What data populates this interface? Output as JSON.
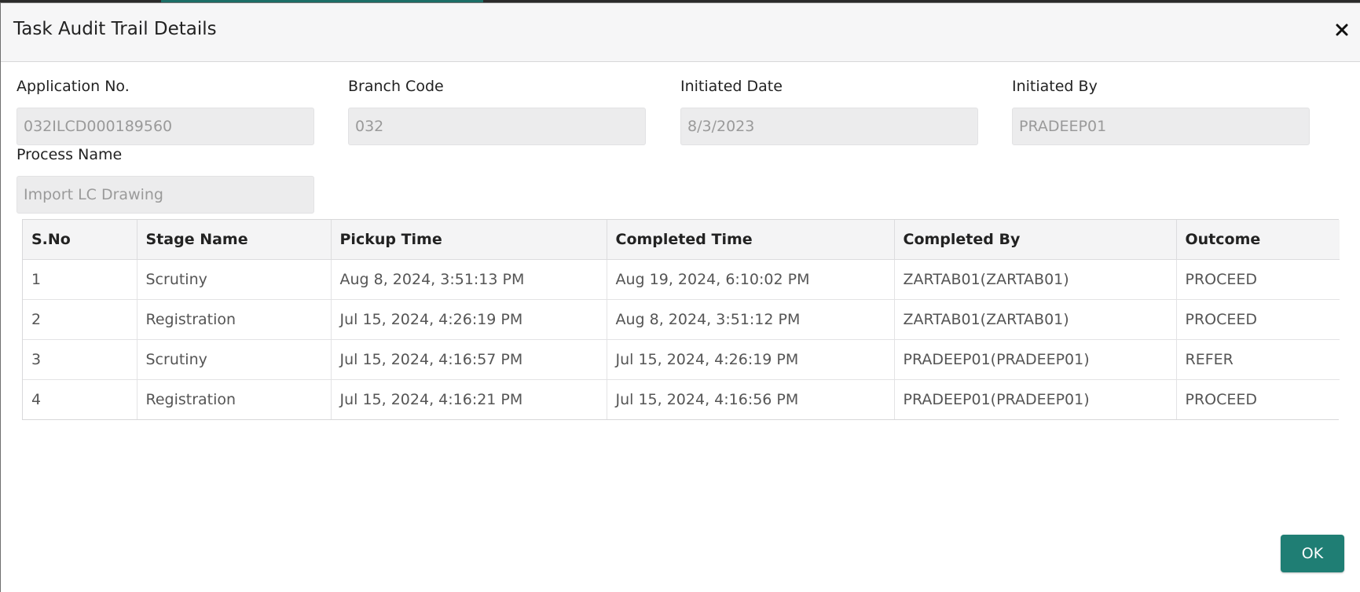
{
  "dialog": {
    "title": "Task Audit Trail Details",
    "close_icon": "close-icon"
  },
  "fields": {
    "application_no": {
      "label": "Application No.",
      "value": "032ILCD000189560"
    },
    "branch_code": {
      "label": "Branch Code",
      "value": "032"
    },
    "initiated_date": {
      "label": "Initiated Date",
      "value": "8/3/2023"
    },
    "initiated_by": {
      "label": "Initiated By",
      "value": "PRADEEP01"
    },
    "process_name": {
      "label": "Process Name",
      "value": "Import LC Drawing"
    }
  },
  "table": {
    "headers": [
      "S.No",
      "Stage Name",
      "Pickup Time",
      "Completed Time",
      "Completed By",
      "Outcome"
    ],
    "rows": [
      [
        "1",
        "Scrutiny",
        "Aug 8, 2024, 3:51:13 PM",
        "Aug 19, 2024, 6:10:02 PM",
        "ZARTAB01(ZARTAB01)",
        "PROCEED"
      ],
      [
        "2",
        "Registration",
        "Jul 15, 2024, 4:26:19 PM",
        "Aug 8, 2024, 3:51:12 PM",
        "ZARTAB01(ZARTAB01)",
        "PROCEED"
      ],
      [
        "3",
        "Scrutiny",
        "Jul 15, 2024, 4:16:57 PM",
        "Jul 15, 2024, 4:26:19 PM",
        "PRADEEP01(PRADEEP01)",
        "REFER"
      ],
      [
        "4",
        "Registration",
        "Jul 15, 2024, 4:16:21 PM",
        "Jul 15, 2024, 4:16:56 PM",
        "PRADEEP01(PRADEEP01)",
        "PROCEED"
      ]
    ]
  },
  "footer": {
    "ok_label": "OK"
  },
  "colors": {
    "accent": "#1f7e74",
    "input_bg": "#ececed",
    "header_bg": "#f6f6f7"
  }
}
